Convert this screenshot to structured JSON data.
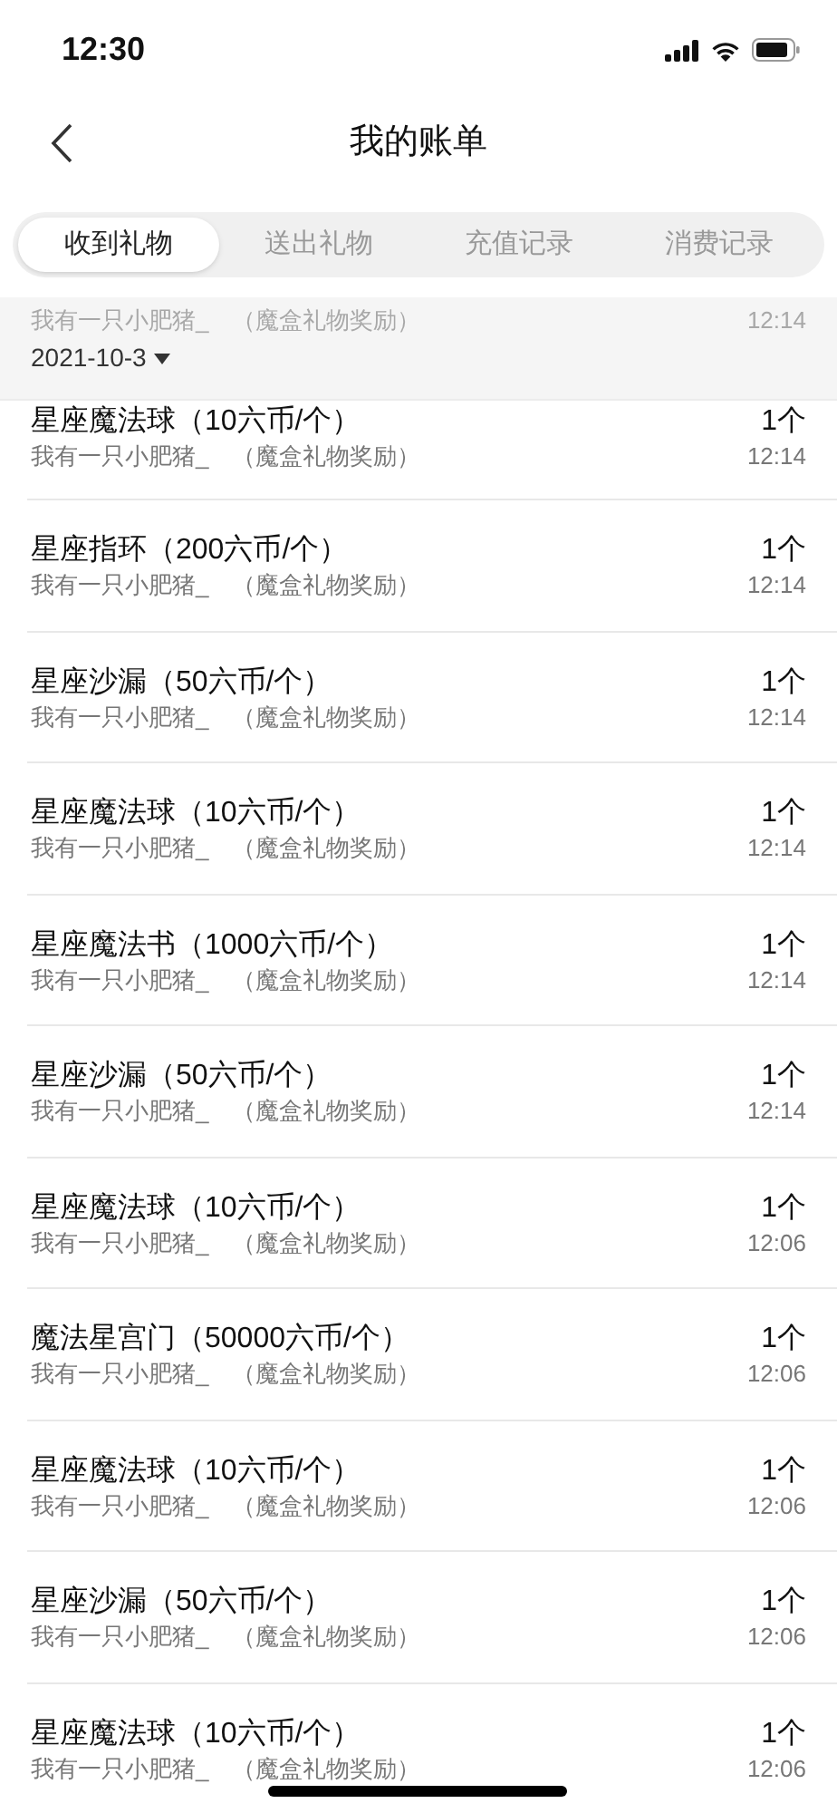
{
  "status_bar": {
    "time": "12:30"
  },
  "nav": {
    "title": "我的账单"
  },
  "tabs": [
    {
      "label": "收到礼物",
      "selected": true
    },
    {
      "label": "送出礼物",
      "selected": false
    },
    {
      "label": "充值记录",
      "selected": false
    },
    {
      "label": "消费记录",
      "selected": false
    }
  ],
  "date_header": {
    "date": "2021-10-3",
    "behind_row": {
      "detail": "我有一只小肥猪_　（魔盒礼物奖励）",
      "time": "12:14"
    }
  },
  "rows": [
    {
      "title": "星座魔法球（10六币/个）",
      "detail": "我有一只小肥猪_　（魔盒礼物奖励）",
      "count": "1个",
      "time": "12:14"
    },
    {
      "title": "星座指环（200六币/个）",
      "detail": "我有一只小肥猪_　（魔盒礼物奖励）",
      "count": "1个",
      "time": "12:14"
    },
    {
      "title": "星座沙漏（50六币/个）",
      "detail": "我有一只小肥猪_　（魔盒礼物奖励）",
      "count": "1个",
      "time": "12:14"
    },
    {
      "title": "星座魔法球（10六币/个）",
      "detail": "我有一只小肥猪_　（魔盒礼物奖励）",
      "count": "1个",
      "time": "12:14"
    },
    {
      "title": "星座魔法书（1000六币/个）",
      "detail": "我有一只小肥猪_　（魔盒礼物奖励）",
      "count": "1个",
      "time": "12:14"
    },
    {
      "title": "星座沙漏（50六币/个）",
      "detail": "我有一只小肥猪_　（魔盒礼物奖励）",
      "count": "1个",
      "time": "12:14"
    },
    {
      "title": "星座魔法球（10六币/个）",
      "detail": "我有一只小肥猪_　（魔盒礼物奖励）",
      "count": "1个",
      "time": "12:06"
    },
    {
      "title": "魔法星宫门（50000六币/个）",
      "detail": "我有一只小肥猪_　（魔盒礼物奖励）",
      "count": "1个",
      "time": "12:06"
    },
    {
      "title": "星座魔法球（10六币/个）",
      "detail": "我有一只小肥猪_　（魔盒礼物奖励）",
      "count": "1个",
      "time": "12:06"
    },
    {
      "title": "星座沙漏（50六币/个）",
      "detail": "我有一只小肥猪_　（魔盒礼物奖励）",
      "count": "1个",
      "time": "12:06"
    },
    {
      "title": "星座魔法球（10六币/个）",
      "detail": "我有一只小肥猪_　（魔盒礼物奖励）",
      "count": "1个",
      "time": "12:06"
    }
  ]
}
